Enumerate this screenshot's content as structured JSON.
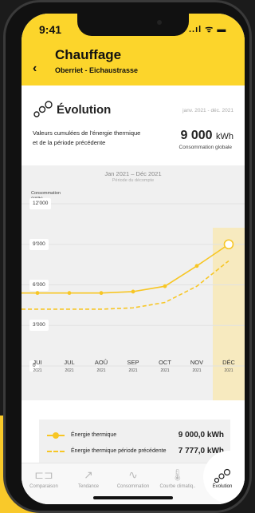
{
  "status_bar": {
    "time": "9:41",
    "icons": "..ıl ᯤ ▬"
  },
  "header": {
    "back_icon": "chevron-left-icon",
    "back_glyph": "‹",
    "title": "Chauffage",
    "subtitle": "Oberriet - Eichaustrasse"
  },
  "section": {
    "title": "Évolution",
    "date_range": "janv. 2021 - déc. 2021",
    "description": "Valeurs cumulées de l’énergie thermique et de la période précédente",
    "total_value": "9 000",
    "total_unit": "kWh",
    "total_label": "Consommation globale"
  },
  "chart_data": {
    "type": "line",
    "title": "Jan 2021 – Déc 2021",
    "subtitle": "Période du décompte",
    "ylabel": "Consommation (kWh)",
    "ylim": [
      0,
      13500
    ],
    "yticks": [
      {
        "value": 0,
        "label": "0"
      },
      {
        "value": 3000,
        "label": "3'000"
      },
      {
        "value": 6000,
        "label": "6'000"
      },
      {
        "value": 9000,
        "label": "9'000"
      },
      {
        "value": 12000,
        "label": "12'000"
      }
    ],
    "categories": [
      {
        "month": "JUI",
        "year": "2021"
      },
      {
        "month": "JUL",
        "year": "2021"
      },
      {
        "month": "AOÛ",
        "year": "2021"
      },
      {
        "month": "SEP",
        "year": "2021"
      },
      {
        "month": "OCT",
        "year": "2021"
      },
      {
        "month": "NOV",
        "year": "2021"
      },
      {
        "month": "DÉC",
        "year": "2021"
      }
    ],
    "highlight_index": 6,
    "series": [
      {
        "name": "Énergie thermique",
        "style": "solid",
        "color": "#f7c625",
        "values": [
          5400,
          5400,
          5400,
          5500,
          5900,
          7400,
          9000
        ]
      },
      {
        "name": "Énergie thermique période précédente",
        "style": "dashed",
        "color": "#f7c625",
        "values": [
          4200,
          4200,
          4200,
          4300,
          4700,
          5900,
          7777
        ]
      }
    ]
  },
  "legend": [
    {
      "label": "Énergie thermique",
      "value": "9 000,0 kWh"
    },
    {
      "label": "Énergie thermique période précédente",
      "value": "7 777,0 kWh"
    }
  ],
  "tabs": [
    {
      "label": "Comparaison",
      "icon": "compare-icon",
      "glyph": "⊏⊐"
    },
    {
      "label": "Tendance",
      "icon": "trend-icon",
      "glyph": "↗"
    },
    {
      "label": "Consommation",
      "icon": "consumption-wave-icon",
      "glyph": "∿"
    },
    {
      "label": "Courbe climatiq..",
      "icon": "thermometer-icon",
      "glyph": "🌡"
    },
    {
      "label": "Évolution",
      "icon": "evolution-icon",
      "glyph": "∘°"
    }
  ],
  "colors": {
    "accent": "#fcd52b",
    "line": "#f7c625",
    "highlight": "#f7eabf"
  }
}
